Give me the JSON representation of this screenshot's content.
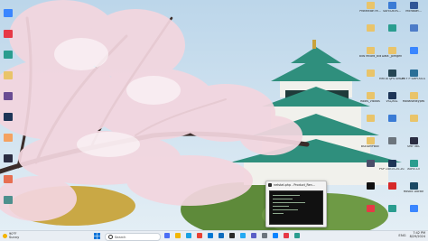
{
  "desktop": {
    "right_icons": [
      {
        "label": "Protection re...",
        "icon": "folder-icon",
        "color": "#e9c46a"
      },
      {
        "label": "SAFEDEVS...",
        "icon": "app-icon",
        "color": "#3a7bd5"
      },
      {
        "label": "Microsoft...",
        "icon": "app-icon",
        "color": "#2f5597"
      },
      {
        "label": "",
        "icon": "folder-icon",
        "color": "#e9c46a"
      },
      {
        "label": "",
        "icon": "app-icon",
        "color": "#2a9d8f"
      },
      {
        "label": "",
        "icon": "app-icon",
        "color": "#4d7cc8"
      },
      {
        "label": "Bills record_bils",
        "icon": "folder-icon",
        "color": "#e9c46a"
      },
      {
        "label": "Data _plmgen",
        "icon": "folder-icon",
        "color": "#e9c46a"
      },
      {
        "label": "",
        "icon": "app-icon",
        "color": "#3a86ff"
      },
      {
        "label": "",
        "icon": "folder-icon",
        "color": "#e9c46a"
      },
      {
        "label": "MRTIA QPS SMDPSTE",
        "icon": "app-icon",
        "color": "#264653"
      },
      {
        "label": "MTF P SMPOOLS",
        "icon": "app-icon",
        "color": "#2a6f97"
      },
      {
        "label": "Roots_Visibos",
        "icon": "folder-icon",
        "color": "#e9c46a"
      },
      {
        "label": "VSL/ASL",
        "icon": "app-icon",
        "color": "#1d3557"
      },
      {
        "label": "Modalstrotypes",
        "icon": "app-icon",
        "color": "#e9c46a"
      },
      {
        "label": "",
        "icon": "folder-icon",
        "color": "#e9c46a"
      },
      {
        "label": "",
        "icon": "app-icon",
        "color": "#3a7bd5"
      },
      {
        "label": "",
        "icon": "app-icon",
        "color": "#e9c46a"
      },
      {
        "label": "BSEIAMPBUE",
        "icon": "folder-icon",
        "color": "#e9c46a"
      },
      {
        "label": "",
        "icon": "app-icon",
        "color": "#6c757d"
      },
      {
        "label": "SHIFTBIL",
        "icon": "app-icon",
        "color": "#2b2d42"
      },
      {
        "label": "",
        "icon": "app-icon",
        "color": "#4a4e69"
      },
      {
        "label": "PSP 14015-20-2024",
        "icon": "app-icon",
        "color": "#1d3557"
      },
      {
        "label": "ASRE-Cll",
        "icon": "app-icon",
        "color": "#2a9d8f"
      },
      {
        "label": "",
        "icon": "app-icon",
        "color": "#111111"
      },
      {
        "label": "",
        "icon": "app-icon",
        "color": "#d62828"
      },
      {
        "label": "Mosaic Doctor",
        "icon": "app-icon",
        "color": "#1b4965"
      },
      {
        "label": "",
        "icon": "app-icon",
        "color": "#e63946"
      },
      {
        "label": "",
        "icon": "app-icon",
        "color": "#2a9d8f"
      },
      {
        "label": "",
        "icon": "app-icon",
        "color": "#3a86ff"
      }
    ],
    "left_icons": [
      {
        "icon": "app-icon",
        "color": "#3a86ff"
      },
      {
        "icon": "app-icon",
        "color": "#e63946"
      },
      {
        "icon": "app-icon",
        "color": "#2a9d8f"
      },
      {
        "icon": "app-icon",
        "color": "#e9c46a"
      },
      {
        "icon": "app-icon",
        "color": "#6a4c93"
      },
      {
        "icon": "app-icon",
        "color": "#1d3557"
      },
      {
        "icon": "app-icon",
        "color": "#f4a261"
      },
      {
        "icon": "app-icon",
        "color": "#2b2d42"
      },
      {
        "icon": "app-icon",
        "color": "#e76f51"
      },
      {
        "icon": "app-icon",
        "color": "#4d908e"
      }
    ]
  },
  "preview": {
    "title": "netstat.php - Product_Ren..."
  },
  "taskbar": {
    "weather_temp": "90°F",
    "weather_desc": "Sunny",
    "search_placeholder": "Search",
    "apps": [
      {
        "icon": "widgets-icon",
        "color": "#4c6ef5"
      },
      {
        "icon": "file-explorer-icon",
        "color": "#f2b705"
      },
      {
        "icon": "edge-icon",
        "color": "#1ba1e2"
      },
      {
        "icon": "chrome-icon",
        "color": "#e94235"
      },
      {
        "icon": "store-icon",
        "color": "#0078d4"
      },
      {
        "icon": "mail-icon",
        "color": "#0f6cbd"
      },
      {
        "icon": "terminal-icon",
        "color": "#2b2b2b"
      },
      {
        "icon": "vscode-icon",
        "color": "#23a9f2"
      },
      {
        "icon": "teams-icon",
        "color": "#5b5fc7"
      },
      {
        "icon": "settings-icon",
        "color": "#6c757d"
      },
      {
        "icon": "photos-icon",
        "color": "#0a84ff"
      },
      {
        "icon": "app-icon",
        "color": "#e63946"
      },
      {
        "icon": "app-icon",
        "color": "#2a9d8f"
      }
    ],
    "system_text": "ENG",
    "time": "7:42 PM",
    "date": "8/29/2024"
  },
  "colors": {
    "sky": "#cfe2ef",
    "castle_roof": "#2f8f7d",
    "castle_wall": "#f1f1ec",
    "blossom": "#f3d6df",
    "trunk": "#3b2d2a",
    "taskbar": "#e9eef4"
  }
}
